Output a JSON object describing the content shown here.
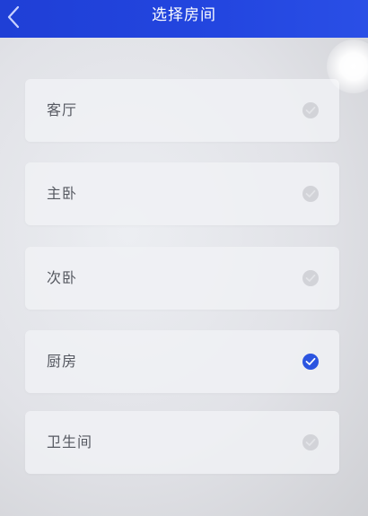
{
  "header": {
    "title": "选择房间"
  },
  "rooms": [
    {
      "label": "客厅",
      "selected": false
    },
    {
      "label": "主卧",
      "selected": false
    },
    {
      "label": "次卧",
      "selected": false
    },
    {
      "label": "厨房",
      "selected": true
    },
    {
      "label": "卫生间",
      "selected": false
    }
  ],
  "colors": {
    "header_bg": "#2346e0",
    "selected_check": "#2b54e0",
    "unselected_check": "#d2d3d8"
  }
}
